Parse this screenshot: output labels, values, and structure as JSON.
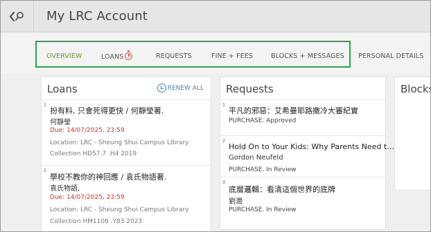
{
  "header": {
    "title": "My LRC Account"
  },
  "tabs": [
    {
      "label": "OVERVIEW"
    },
    {
      "label": "LOANS"
    },
    {
      "label": "REQUESTS"
    },
    {
      "label": "FINE + FEES"
    },
    {
      "label": "BLOCKS + MESSAGES"
    },
    {
      "label": "PERSONAL DETAILS"
    }
  ],
  "colors": {
    "active_tab": "#6a9a2a",
    "highlight_box": "#2aa34a",
    "due_date": "#d0312d",
    "renew_link": "#3f7fc4",
    "loans_timer_icon": "#e04f3a"
  },
  "loans": {
    "title": "Loans",
    "renew_all_label": "RENEW ALL",
    "items": [
      {
        "num": "1",
        "title": "扮有料, 只會死得更快 / 何靜瑩著.",
        "author": "何靜瑩",
        "due": "Due: 14/07/2025, 23:59",
        "location": "Location: LRC - Sheung Shui Campus Library",
        "collection": "Collection HD57.7 .H4 2019"
      },
      {
        "num": "2",
        "title": "學校不教你的神回應 / 袁氏物語著.",
        "author": "袁氏物語,",
        "due": "Due: 14/07/2025, 23:59",
        "location": "Location: LRC - Sheung Shui Campus Library",
        "collection": "Collection HM1106 .Y83 2023"
      }
    ]
  },
  "requests": {
    "title": "Requests",
    "items": [
      {
        "num": "1",
        "title": "平凡的邪惡：艾希曼耶路撒冷大審紀實",
        "author": "",
        "status": "PURCHASE. Approved"
      },
      {
        "num": "2",
        "title": "Hold On to Your Kids: Why Parents Need t…",
        "author": "Gordon Neufeld",
        "status": "PURCHASE. In Review"
      },
      {
        "num": "3",
        "title": "底層邏輯：看清這個世界的底牌",
        "author": "劉潤",
        "status": "PURCHASE. In Review"
      }
    ]
  },
  "blocks": {
    "title": "Blocks"
  }
}
